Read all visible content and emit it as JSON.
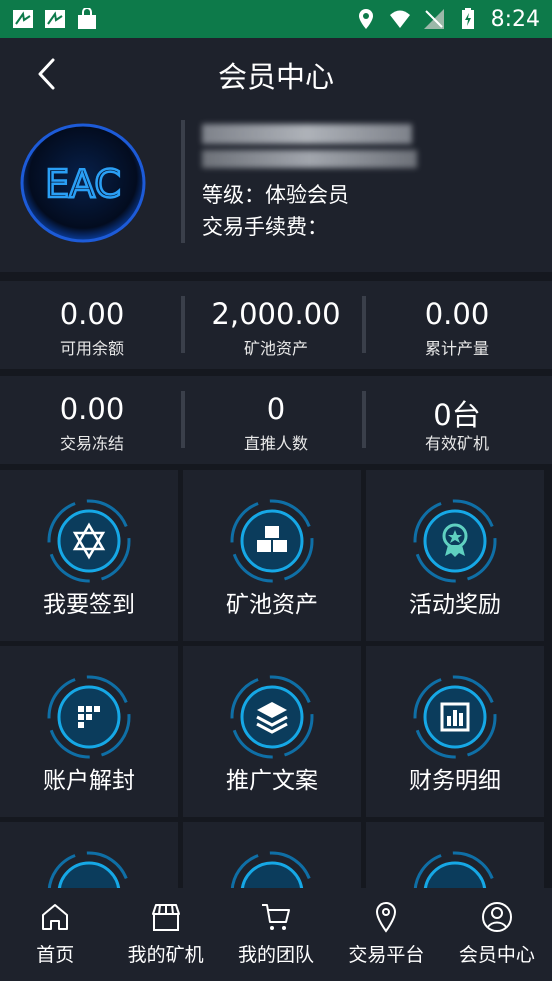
{
  "status_bar": {
    "time": "8:24"
  },
  "header": {
    "title": "会员中心"
  },
  "profile": {
    "avatar_text": "EAC",
    "level": "等级：体验会员",
    "fee": "交易手续费："
  },
  "stats_row1": [
    {
      "value": "0.00",
      "label": "可用余额"
    },
    {
      "value": "2,000.00",
      "label": "矿池资产"
    },
    {
      "value": "0.00",
      "label": "累计产量"
    }
  ],
  "stats_row2": [
    {
      "value": "0.00",
      "label": "交易冻结"
    },
    {
      "value": "0",
      "label": "直推人数"
    },
    {
      "value": "0台",
      "label": "有效矿机"
    }
  ],
  "menu": [
    {
      "label": "我要签到",
      "icon": "sign-in-icon"
    },
    {
      "label": "矿池资产",
      "icon": "cubes-icon"
    },
    {
      "label": "活动奖励",
      "icon": "medal-icon"
    },
    {
      "label": "账户解封",
      "icon": "grid-dots-icon"
    },
    {
      "label": "推广文案",
      "icon": "layers-icon"
    },
    {
      "label": "财务明细",
      "icon": "bar-chart-icon"
    }
  ],
  "nav": [
    {
      "label": "首页",
      "icon": "home-icon"
    },
    {
      "label": "我的矿机",
      "icon": "store-icon"
    },
    {
      "label": "我的团队",
      "icon": "cart-icon"
    },
    {
      "label": "交易平台",
      "icon": "location-icon"
    },
    {
      "label": "会员中心",
      "icon": "user-icon"
    }
  ],
  "colors": {
    "status_bar": "#0d7a4a",
    "panel": "#1e222c",
    "background": "#15181f",
    "accent": "#16a8e6"
  }
}
